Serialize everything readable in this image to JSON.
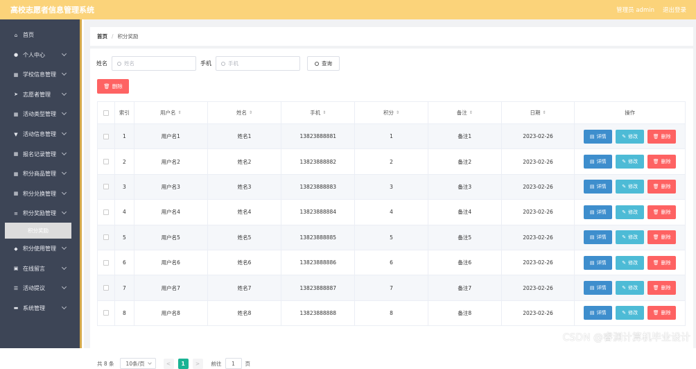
{
  "header": {
    "title": "高校志愿者信息管理系统",
    "user": "管理员 admin",
    "logout": "退出登录"
  },
  "sidebar": {
    "items": [
      {
        "label": "首页",
        "icon": "home-icon",
        "chev": false
      },
      {
        "label": "个人中心",
        "icon": "user-icon",
        "chev": true
      },
      {
        "label": "学校信息管理",
        "icon": "grid-icon",
        "chev": true
      },
      {
        "label": "志愿者管理",
        "icon": "send-icon",
        "chev": true
      },
      {
        "label": "活动类型管理",
        "icon": "grid-icon",
        "chev": true
      },
      {
        "label": "活动信息管理",
        "icon": "trophy-icon",
        "chev": true
      },
      {
        "label": "报名记录管理",
        "icon": "grid-icon",
        "chev": true
      },
      {
        "label": "积分商品管理",
        "icon": "grid-icon",
        "chev": true
      },
      {
        "label": "积分兑换管理",
        "icon": "grid-icon",
        "chev": true
      },
      {
        "label": "积分奖励管理",
        "icon": "bars-icon",
        "chev": true
      }
    ],
    "active_sub": "积分奖励",
    "items2": [
      {
        "label": "积分使用管理",
        "icon": "pin-icon",
        "chev": true
      },
      {
        "label": "在线留言",
        "icon": "house-icon",
        "chev": true
      },
      {
        "label": "活动提议",
        "icon": "sliders-icon",
        "chev": true
      },
      {
        "label": "系统管理",
        "icon": "chat-icon",
        "chev": true
      }
    ]
  },
  "breadcrumb": {
    "home": "首页",
    "sep": "/",
    "current": "积分奖励"
  },
  "search": {
    "name_label": "姓名",
    "name_placeholder": "姓名",
    "phone_label": "手机",
    "phone_placeholder": "手机",
    "query": "查询"
  },
  "delete_label": "删除",
  "table": {
    "headers": [
      "索引",
      "用户名",
      "姓名",
      "手机",
      "积分",
      "备注",
      "日期",
      "操作"
    ],
    "rows": [
      {
        "idx": "1",
        "username": "用户名1",
        "name": "姓名1",
        "phone": "13823888881",
        "points": "1",
        "note": "备注1",
        "date": "2023-02-26"
      },
      {
        "idx": "2",
        "username": "用户名2",
        "name": "姓名2",
        "phone": "13823888882",
        "points": "2",
        "note": "备注2",
        "date": "2023-02-26"
      },
      {
        "idx": "3",
        "username": "用户名3",
        "name": "姓名3",
        "phone": "13823888883",
        "points": "3",
        "note": "备注3",
        "date": "2023-02-26"
      },
      {
        "idx": "4",
        "username": "用户名4",
        "name": "姓名4",
        "phone": "13823888884",
        "points": "4",
        "note": "备注4",
        "date": "2023-02-26"
      },
      {
        "idx": "5",
        "username": "用户名5",
        "name": "姓名5",
        "phone": "13823888885",
        "points": "5",
        "note": "备注5",
        "date": "2023-02-26"
      },
      {
        "idx": "6",
        "username": "用户名6",
        "name": "姓名6",
        "phone": "13823888886",
        "points": "6",
        "note": "备注6",
        "date": "2023-02-26"
      },
      {
        "idx": "7",
        "username": "用户名7",
        "name": "姓名7",
        "phone": "13823888887",
        "points": "7",
        "note": "备注7",
        "date": "2023-02-26"
      },
      {
        "idx": "8",
        "username": "用户名8",
        "name": "姓名8",
        "phone": "13823888888",
        "points": "8",
        "note": "备注8",
        "date": "2023-02-26"
      }
    ],
    "actions": {
      "detail": "详情",
      "edit": "修改",
      "del": "删除"
    }
  },
  "pagination": {
    "total": "共 8 条",
    "page_size": "10条/页",
    "prev": "<",
    "page": "1",
    "next": ">",
    "goto": "前往",
    "goto_value": "1",
    "page_suffix": "页"
  },
  "watermark": "CSDN @睿渊计算机毕业设计"
}
